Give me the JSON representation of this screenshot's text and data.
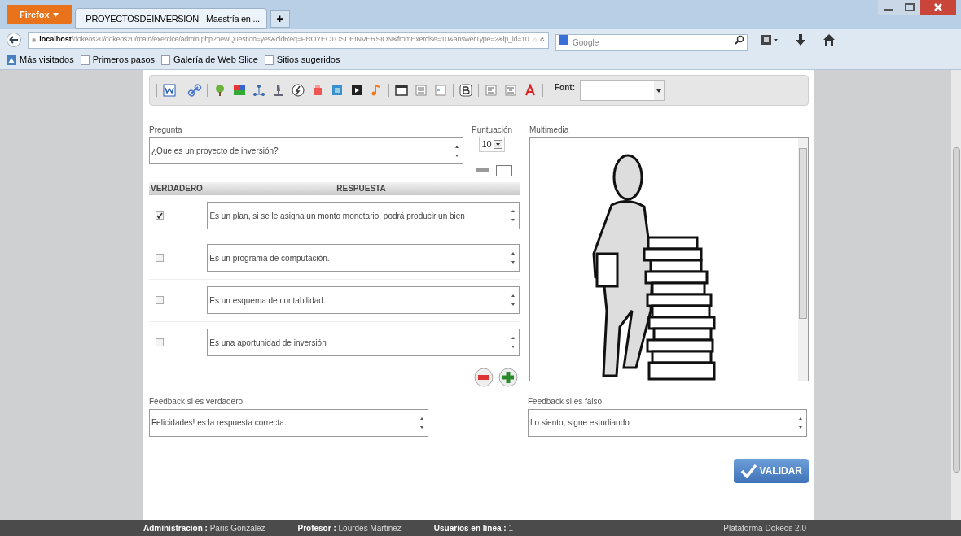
{
  "browser": {
    "menu_button": "Firefox",
    "tab_title": "PROYECTOSDEINVERSION - Maestría en ...",
    "new_tab": "+",
    "url_host": "localhost",
    "url_path": "/dokeos20/dokeos20/main/exercice/admin.php?newQuestion=yes&cidReq=PROYECTOSDEINVERSION&fromExercise=10&answerType=2&lp_id=10",
    "search_placeholder": "Google",
    "bookmarks": [
      "Más visitados",
      "Primeros pasos",
      "Galería de Web Slice",
      "Sitios sugeridos"
    ]
  },
  "toolbar": {
    "font_label": "Font:"
  },
  "question": {
    "label": "Pregunta",
    "value": "¿Que es un proyecto de inversión?"
  },
  "score": {
    "label": "Puntuación",
    "value": "10"
  },
  "multimedia": {
    "label": "Multimedia"
  },
  "answers_table": {
    "columns": [
      "VERDADERO",
      "RESPUESTA"
    ],
    "rows": [
      {
        "text": "Es un plan, si se le asigna un monto monetario, podrá producir un bien",
        "checked": true
      },
      {
        "text": "Es un programa de computación.",
        "checked": false
      },
      {
        "text": "Es un esquema de contabilidad.",
        "checked": false
      },
      {
        "text": "Es una aportunidad de inversión",
        "checked": false
      }
    ]
  },
  "feedback": [
    {
      "label": "Feedback si es verdadero",
      "value": "Felicidades! es la respuesta correcta."
    },
    {
      "label": "Feedback si es falso",
      "value": "Lo siento, sigue estudiando"
    }
  ],
  "validate_button": "VALIDAR",
  "footer": {
    "items": [
      {
        "label": "Administración :",
        "value": "Paris Gonzalez"
      },
      {
        "label": "Profesor :",
        "value": "Lourdes Martinez"
      },
      {
        "label": "Usuarios en linea :",
        "value": "1"
      }
    ],
    "platform": "Plataforma Dokeos 2.0"
  }
}
